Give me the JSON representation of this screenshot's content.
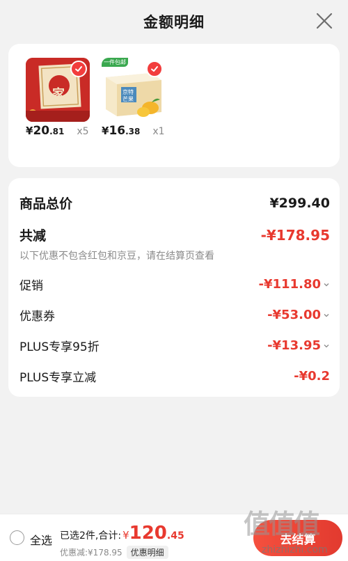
{
  "header": {
    "title": "金额明细"
  },
  "products": [
    {
      "price_yen": "¥",
      "price_int": "20",
      "price_dec": ".81",
      "qty": "x5",
      "selected": true,
      "image": "red-gift-box-image",
      "box_text": "家"
    },
    {
      "price_yen": "¥",
      "price_int": "16",
      "price_dec": ".38",
      "qty": "x1",
      "selected": true,
      "image": "mango-box-image",
      "badge": "一件包邮",
      "box_text": "京特芒果"
    }
  ],
  "detail": {
    "total": {
      "label": "商品总价",
      "value": "¥299.40"
    },
    "reduce": {
      "label": "共减",
      "value": "-¥178.95"
    },
    "note": "以下优惠不包含红包和京豆，请在结算页查看",
    "items": [
      {
        "label": "促销",
        "value": "-¥111.80"
      },
      {
        "label": "优惠券",
        "value": "-¥53.00"
      },
      {
        "label": "PLUS专享95折",
        "value": "-¥13.95"
      },
      {
        "label": "PLUS专享立减",
        "value": "-¥0.2"
      }
    ]
  },
  "bottom_bar": {
    "select_all": "全选",
    "summary_label": "已选2件,合计:",
    "total_yen": "¥",
    "total_int": "120",
    "total_dec": ".45",
    "discount_label": "优惠减:¥178.95",
    "detail_button": "优惠明细",
    "checkout_button": "去结算"
  },
  "watermark": {
    "big": "值值值",
    "small": "zhizhizhi.com"
  },
  "colors": {
    "accent_red": "#e8392f",
    "background": "#f2f2f2",
    "card": "#ffffff"
  }
}
